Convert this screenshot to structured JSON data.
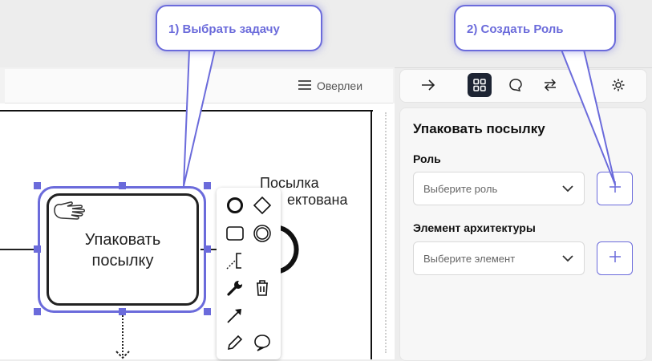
{
  "canvas": {
    "overlay_button_label": "Оверлеи",
    "task_label": "Упаковать посылку",
    "event_label_line1": "Посылка",
    "event_label_line2": "ектована"
  },
  "context_pad": {
    "items": [
      "start-event-icon",
      "gateway-icon",
      "task-icon",
      "intermediate-event-icon",
      "annotation-icon",
      "wrench-icon",
      "delete-icon",
      "connect-arrow-icon",
      "edit-pencil-icon",
      "comment-icon"
    ]
  },
  "panel": {
    "toolbar_icons": [
      "arrow-right-icon",
      "grid-icon",
      "chat-icon",
      "swap-icon",
      "help-icon",
      "gear-icon"
    ],
    "title": "Упаковать посылку",
    "role_label": "Роль",
    "role_placeholder": "Выберите роль",
    "arch_label": "Элемент архитектуры",
    "arch_placeholder": "Выберите элемент"
  },
  "callouts": {
    "step1": "1) Выбрать задачу",
    "step2": "2) Создать Роль"
  },
  "colors": {
    "accent": "#6b6bdb",
    "dark_button": "#1d2433",
    "line": "#222222"
  }
}
